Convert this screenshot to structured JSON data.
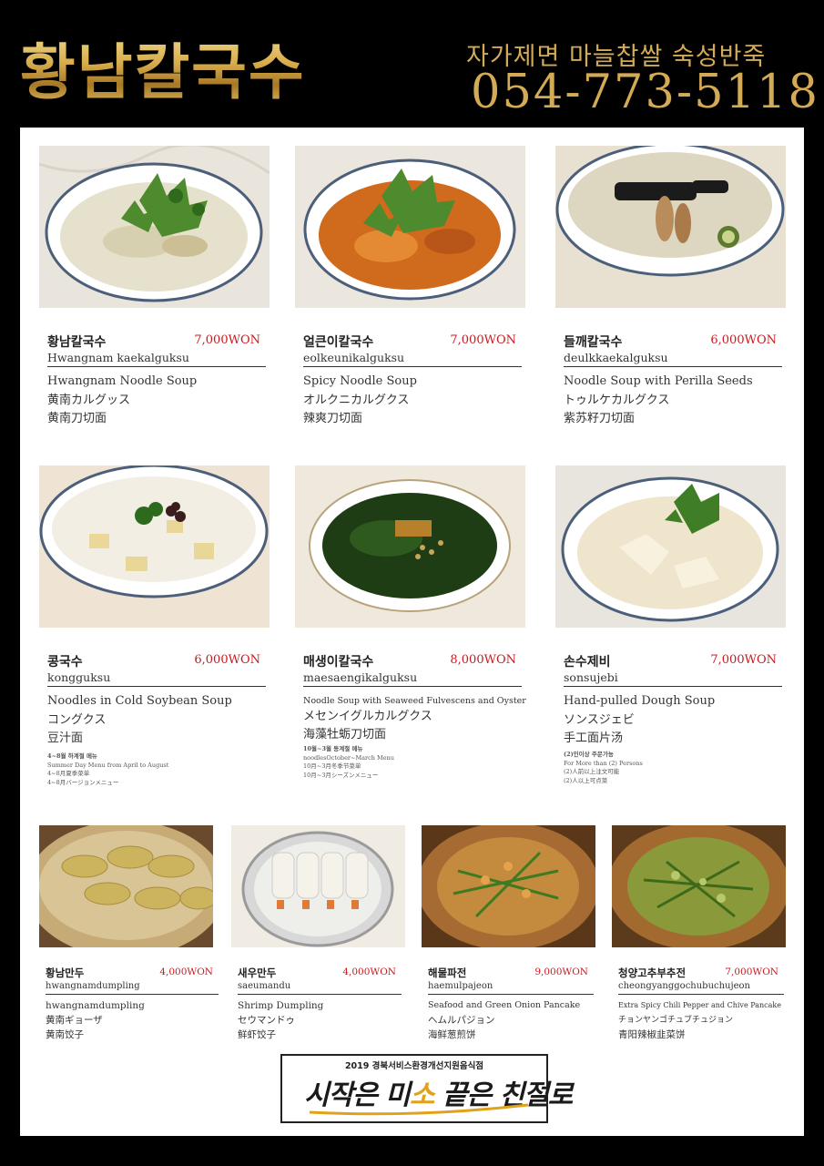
{
  "header": {
    "brand": "황남칼국수",
    "tagline": "자가제면 마늘찹쌀 숙성반죽",
    "phone": "054-773-5118"
  },
  "colors": {
    "gold": "#d3aa55",
    "price_red": "#c8191e",
    "background": "#000000"
  },
  "menu": [
    {
      "name": "황남칼국수",
      "price": "7,000WON",
      "roman": "Hwangnam kaekalguksu",
      "desc": [
        "Hwangnam Noodle Soup",
        "黄南カルグッス",
        "黄南刀切面"
      ]
    },
    {
      "name": "얼큰이칼국수",
      "price": "7,000WON",
      "roman": "eolkeunikalguksu",
      "desc": [
        "Spicy Noodle Soup",
        "オルクニカルグクス",
        "辣爽刀切面"
      ]
    },
    {
      "name": "들깨칼국수",
      "price": "6,000WON",
      "roman": "deulkkaekalguksu",
      "desc": [
        "Noodle Soup with Perilla Seeds",
        "トゥルケカルグクス",
        "紫苏籽刀切面"
      ]
    },
    {
      "name": "콩국수",
      "price": "6,000WON",
      "roman": "kongguksu",
      "desc": [
        "Noodles in Cold Soybean Soup",
        "コングクス",
        "豆汁面"
      ],
      "notes": [
        "4~8월 하계절 메뉴",
        "Summer Day Menu from April to August",
        "4~8月夏季菜单",
        "4~8月バージョンメニュー"
      ]
    },
    {
      "name": "매생이칼국수",
      "price": "8,000WON",
      "roman": "maesaengikalguksu",
      "desc": [
        "Noodle Soup with Seaweed Fulvescens and Oyster",
        "メセンイグルカルグクス",
        "海藻牡蛎刀切面"
      ],
      "notes": [
        "10월~3월 동계절 메뉴",
        "noodlesOctober~March Menu",
        "10月~3月冬季节菜单",
        "10月~3月シーズンメニュー"
      ]
    },
    {
      "name": "손수제비",
      "price": "7,000WON",
      "roman": "sonsujebi",
      "desc": [
        "Hand-pulled Dough Soup",
        "ソンスジェビ",
        "手工面片汤"
      ],
      "notes": [
        "(2)인이상 주문가능",
        "For More than (2) Persons",
        "(2)人前以上注文可能",
        "(2)人以上可点菜"
      ]
    },
    {
      "name": "황남만두",
      "price": "4,000WON",
      "roman": "hwangnamdumpling",
      "desc": [
        "hwangnamdumpling",
        "黄南ギョーザ",
        "黄南饺子"
      ]
    },
    {
      "name": "새우만두",
      "price": "4,000WON",
      "roman": "saeumandu",
      "desc": [
        "Shrimp Dumpling",
        "セウマンドゥ",
        "鲜虾饺子"
      ]
    },
    {
      "name": "해물파전",
      "price": "9,000WON",
      "roman": "haemulpajeon",
      "desc": [
        "Seafood and Green Onion Pancake",
        "ヘムルパジョン",
        "海鲜葱煎饼"
      ]
    },
    {
      "name": "청양고추부추전",
      "price": "7,000WON",
      "roman": "cheongyanggochubuchujeon",
      "desc": [
        "Extra Spicy Chili Pepper and Chive Pancake",
        "チョンヤンゴチュブチュジョン",
        "青阳辣椒韭菜饼"
      ]
    }
  ],
  "badge": {
    "caption": "2019 경북서비스환경개선지원음식점",
    "slogan_a": "시작은 미",
    "slogan_b": "소",
    "slogan_c": " 끝은 친절로"
  }
}
